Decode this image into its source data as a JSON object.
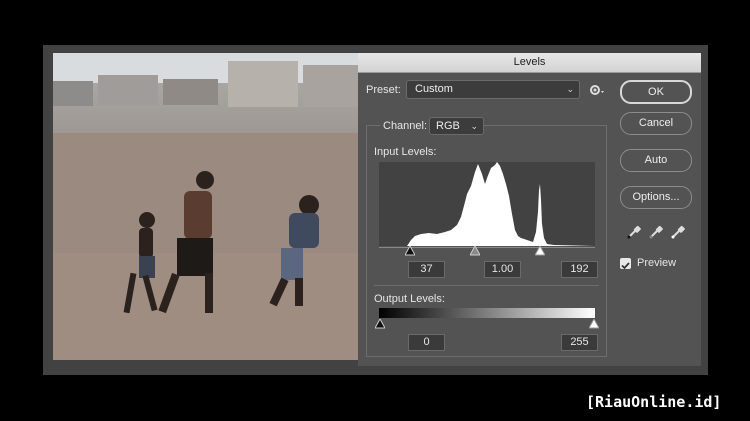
{
  "dialog": {
    "title": "Levels",
    "preset_label": "Preset:",
    "preset_value": "Custom",
    "channel_label": "Channel:",
    "channel_value": "RGB",
    "input_levels_label": "Input Levels:",
    "input_black": "37",
    "input_gamma": "1.00",
    "input_white": "192",
    "output_levels_label": "Output Levels:",
    "output_black": "0",
    "output_white": "255",
    "preview_label": "Preview",
    "preview_checked": true
  },
  "buttons": {
    "ok": "OK",
    "cancel": "Cancel",
    "auto": "Auto",
    "options": "Options..."
  },
  "icons": {
    "gear": "gear-icon",
    "eyedroppers": [
      "black-eyedropper-icon",
      "gray-eyedropper-icon",
      "white-eyedropper-icon"
    ]
  },
  "watermark": "[RiauOnline.id]",
  "colors": {
    "dialog_bg": "#535353",
    "histogram_bg": "#424242",
    "histogram_fill": "#ffffff"
  }
}
